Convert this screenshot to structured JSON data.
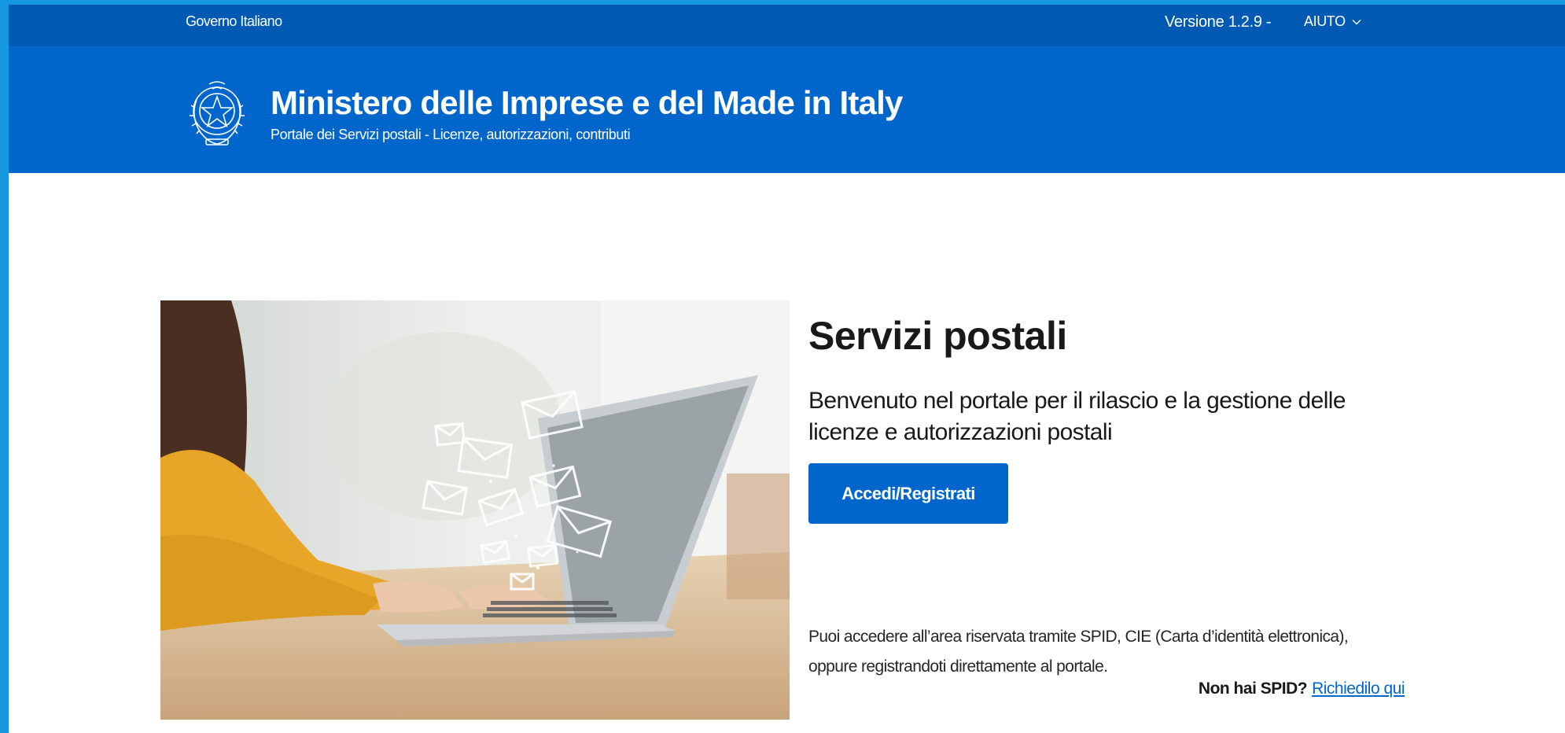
{
  "slim_header": {
    "owner_link": "Governo Italiano",
    "version": "Versione 1.2.9 -",
    "help_label": "AIUTO"
  },
  "header": {
    "title": "Ministero delle Imprese e del Made in Italy",
    "subtitle": "Portale dei Servizi postali - Licenze, autorizzazioni, contributi"
  },
  "main": {
    "title": "Servizi postali",
    "lead": "Benvenuto nel portale per il rilascio e la gestione delle licenze e autorizzazioni postali",
    "login_button": "Accedi/Registrati",
    "info": "Puoi accedere all’area riservata tramite SPID, CIE (Carta d’identità elettronica), oppure registrandoti direttamente al portale.",
    "no_spid_label": "Non hai SPID?",
    "no_spid_link": "Richiedilo qui"
  },
  "colors": {
    "slim_header_bg": "#0059b2",
    "header_bg": "#0066cc",
    "primary": "#0066cc",
    "page_border": "#1598e0"
  },
  "icons": {
    "emblem": "italian-republic-emblem-icon",
    "help_chevron": "chevron-down-icon",
    "envelopes": "envelope-icon"
  }
}
